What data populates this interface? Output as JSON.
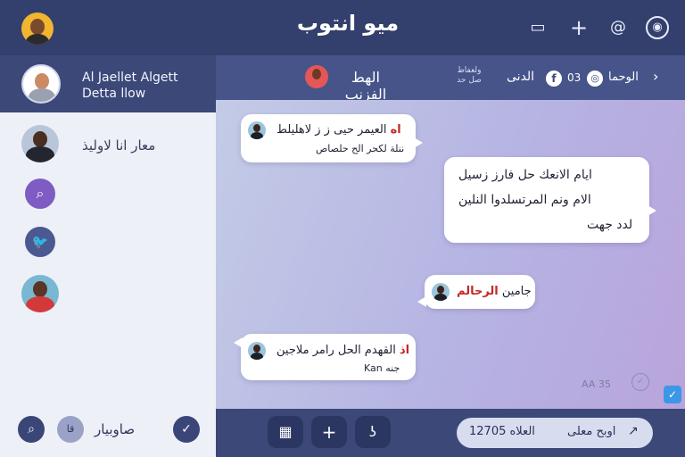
{
  "header": {
    "title": "ميو انتوب",
    "icons": [
      "chat-icon",
      "plus-icon",
      "at-icon",
      "bell-icon"
    ]
  },
  "sidebar": {
    "profile_name_line1": "Al Jaellet Algett",
    "profile_name_line2": "Detta llow",
    "contact_name": "معار انا لاوليذ",
    "footer": {
      "badge": "قا",
      "label": "صاوبيار"
    }
  },
  "chat_header": {
    "name": "الهط الفزنب",
    "status": "ولعفاط صل حد",
    "text1": "الدنى",
    "count": "03",
    "text2": "الوحما"
  },
  "messages": [
    {
      "highlight": "اه",
      "text": " العيمر حيى ز ز لاهليلط",
      "sub": "ننلة لكحر الح حلصاص"
    },
    {
      "line1": "ايام الانعك حل فارز زسيل",
      "line2": "الام ونم المرتسلدوا النلين",
      "line3": "لدد جهت"
    },
    {
      "text": "جامين ",
      "highlight": "الرحالم"
    },
    {
      "highlight": "اذ",
      "text": " القهدم الحل رامر ملاجين",
      "sub": "Kan جنه"
    }
  ],
  "chat_meta": {
    "time": "AA 35"
  },
  "composer": {
    "value": "العلاه 12705",
    "placeholder": "اوبح معلى"
  }
}
